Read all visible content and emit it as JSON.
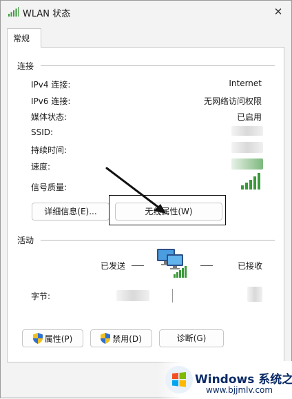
{
  "window": {
    "title": "WLAN 状态",
    "close_glyph": "✕"
  },
  "tabs": [
    {
      "label": "常规",
      "active": true
    }
  ],
  "connection": {
    "section_label": "连接",
    "rows": [
      {
        "label": "IPv4 连接:",
        "value": "Internet"
      },
      {
        "label": "IPv6 连接:",
        "value": "无网络访问权限"
      },
      {
        "label": "媒体状态:",
        "value": "已启用"
      },
      {
        "label": "SSID:",
        "value": ""
      },
      {
        "label": "持续时间:",
        "value": ""
      },
      {
        "label": "速度:",
        "value": ""
      },
      {
        "label": "信号质量:",
        "value": ""
      }
    ],
    "signal_icon": "wifi-signal-bars-icon"
  },
  "buttons": {
    "details": "详细信息(E)...",
    "wireless_properties": "无线属性(W)"
  },
  "activity": {
    "section_label": "活动",
    "sent_label": "已发送",
    "received_label": "已接收",
    "bytes_label": "字节:",
    "network_icon": "network-computers-icon"
  },
  "bottom_buttons": {
    "properties": "属性(P)",
    "disable": "禁用(D)",
    "diagnose": "诊断(G)",
    "shield_icon": "uac-shield-icon"
  },
  "watermark": {
    "brand": "Windows",
    "site_name": "系统之家",
    "url": "www.bjjmlv.com"
  },
  "colors": {
    "signal_green": "#3a9a3a",
    "panel_bg": "#ffffff",
    "window_bg": "#f3f3f3"
  }
}
